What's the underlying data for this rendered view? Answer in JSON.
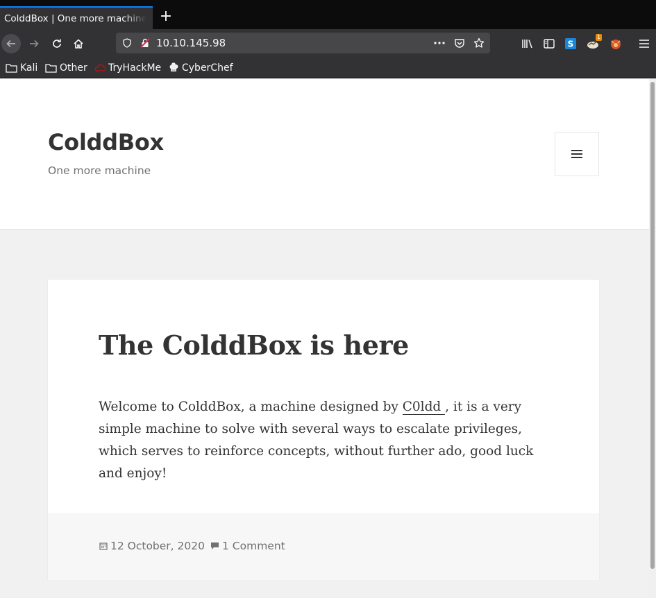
{
  "browser": {
    "tab_title": "ColddBox | One more machine",
    "new_tab_icon": "+",
    "url": "10.10.145.98",
    "extension_badge": "1"
  },
  "bookmarks": [
    {
      "label": "Kali",
      "icon": "folder-icon"
    },
    {
      "label": "Other",
      "icon": "folder-icon"
    },
    {
      "label": "TryHackMe",
      "icon": "tryhackme-icon"
    },
    {
      "label": "CyberChef",
      "icon": "cyberchef-icon"
    }
  ],
  "site": {
    "title": "ColddBox",
    "description": "One more machine"
  },
  "post": {
    "title": "The ColddBox is here",
    "body_before": "Welcome to ColddBox, a machine designed by ",
    "link_text": "C0ldd ",
    "body_after": ", it is a very simple machine to solve with several ways to escalate privileges, which serves to reinforce concepts, without further ado, good luck and enjoy!",
    "date": "12 October, 2020",
    "comments": "1 Comment"
  },
  "colors": {
    "chrome_dark": "#0c0c0d",
    "toolbar": "#323234",
    "accent": "#0a84ff",
    "text": "#333333",
    "muted": "#707070"
  }
}
